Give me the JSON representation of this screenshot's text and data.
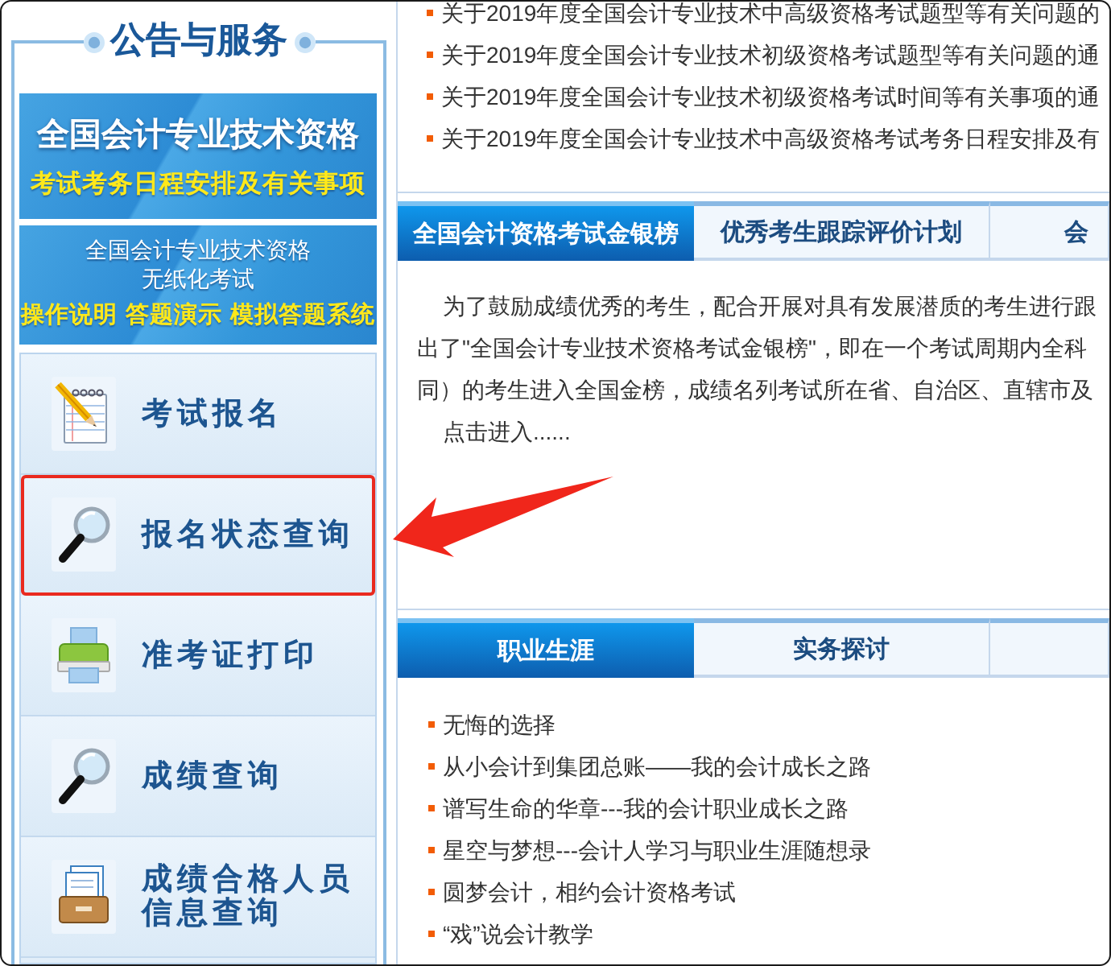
{
  "sidebar": {
    "title": "公告与服务",
    "banners": [
      {
        "kind": "large",
        "lines": [
          {
            "kind": "title",
            "text": "全国会计专业技术资格"
          },
          {
            "kind": "highlight",
            "text": "考试考务日程安排及有关事项"
          }
        ]
      },
      {
        "kind": "compact",
        "lines": [
          {
            "kind": "subtitle",
            "text": "全国会计专业技术资格"
          },
          {
            "kind": "subtitle",
            "text": "无纸化考试"
          },
          {
            "kind": "highlight",
            "text": "操作说明 答题演示 模拟答题系统"
          }
        ]
      }
    ],
    "menu_items": [
      {
        "label": "考试报名",
        "highlighted": false
      },
      {
        "label": "报名状态查询",
        "highlighted": true
      },
      {
        "label": "准考证打印",
        "highlighted": false
      },
      {
        "label": "成绩查询",
        "highlighted": false
      },
      {
        "label": "成绩合格人员信息查询",
        "highlighted": false
      }
    ]
  },
  "announcements": [
    "关于2019年度全国会计专业技术中高级资格考试题型等有关问题的",
    "关于2019年度全国会计专业技术初级资格考试题型等有关问题的通",
    "关于2019年度全国会计专业技术初级资格考试时间等有关事项的通",
    "关于2019年度全国会计专业技术中高级资格考试考务日程安排及有"
  ],
  "sections": [
    {
      "kind": "text",
      "tabs": [
        {
          "label": "全国会计资格考试金银榜",
          "selected": true
        },
        {
          "label": "优秀考生跟踪评价计划",
          "selected": false
        },
        {
          "label": "会",
          "selected": false
        }
      ],
      "paragraph_lines": [
        "为了鼓励成绩优秀的考生，配合开展对具有发展潜质的考生进行跟",
        "出了\"全国会计专业技术资格考试金银榜\"，即在一个考试周期内全科",
        "同）的考生进入全国金榜，成绩名列考试所在省、自治区、直辖市及"
      ],
      "link": "点击进入......"
    },
    {
      "kind": "list",
      "tabs": [
        {
          "label": "职业生涯",
          "selected": true
        },
        {
          "label": "实务探讨",
          "selected": false
        },
        {
          "selected": false
        }
      ],
      "items": [
        "无悔的选择",
        "从小会计到集团总账——我的会计成长之路",
        "谱写生命的华章---我的会计职业成长之路",
        "星空与梦想---会计人学习与职业生涯随想录",
        "圆梦会计，相约会计资格考试",
        "“戏”说会计教学"
      ]
    }
  ]
}
